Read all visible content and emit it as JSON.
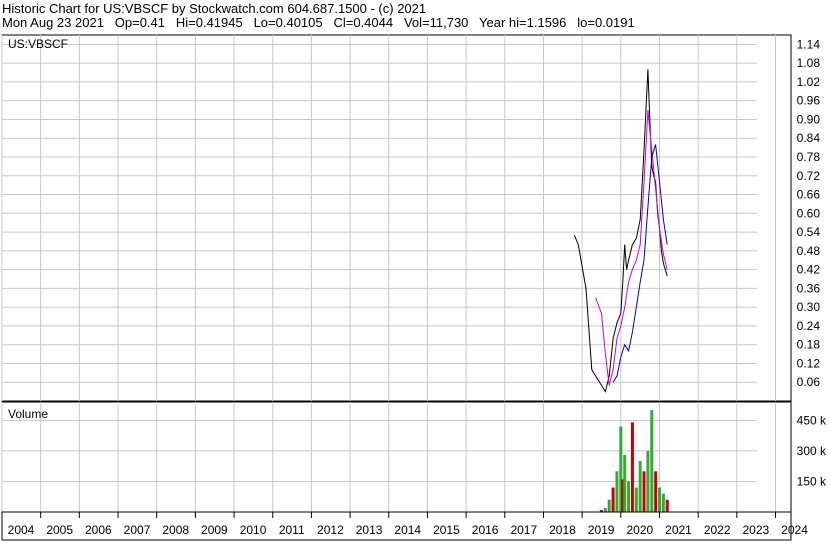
{
  "header": {
    "line1": "Historic Chart for US:VBSCF by Stockwatch.com 604.687.1500 - (c) 2021",
    "line2_date": "Mon Aug 23 2021",
    "line2_op": "Op=0.41",
    "line2_hi": "Hi=0.41945",
    "line2_lo": "Lo=0.40105",
    "line2_cl": "Cl=0.4044",
    "line2_vol": "Vol=11,730",
    "line2_yearhi": "Year hi=1.1596",
    "line2_lo2": "lo=0.0191"
  },
  "chart_data": [
    {
      "type": "line",
      "title": "US:VBSCF",
      "ylim": [
        0.0,
        1.17
      ],
      "y_ticks": [
        "1.14",
        "1.08",
        "1.02",
        "0.96",
        "0.90",
        "0.84",
        "0.78",
        "0.72",
        "0.66",
        "0.60",
        "0.54",
        "0.48",
        "0.42",
        "0.36",
        "0.30",
        "0.24",
        "0.18",
        "0.12",
        "0.06"
      ],
      "x_ticks": [
        "2004",
        "2005",
        "2006",
        "2007",
        "2008",
        "2009",
        "2010",
        "2011",
        "2012",
        "2013",
        "2014",
        "2015",
        "2016",
        "2017",
        "2018",
        "2019",
        "2020",
        "2021",
        "2022",
        "2023",
        "2024"
      ],
      "xlim": [
        2004.0,
        2024.4
      ],
      "grid": true,
      "series": [
        {
          "x": [
            2018.8,
            2018.9,
            2019.0,
            2019.1,
            2019.25,
            2019.4,
            2019.5,
            2019.6,
            2019.7,
            2019.8,
            2019.9,
            2020.0,
            2020.05,
            2020.1,
            2020.15,
            2020.2,
            2020.3,
            2020.4,
            2020.5,
            2020.6,
            2020.7,
            2020.75,
            2020.8,
            2020.85,
            2020.9,
            2020.95,
            2021.0,
            2021.05,
            2021.1,
            2021.15,
            2021.2
          ],
          "y": [
            0.53,
            0.5,
            0.43,
            0.36,
            0.1,
            0.07,
            0.05,
            0.03,
            0.08,
            0.2,
            0.25,
            0.28,
            0.38,
            0.5,
            0.42,
            0.45,
            0.5,
            0.52,
            0.58,
            0.8,
            1.06,
            0.9,
            0.75,
            0.72,
            0.7,
            0.6,
            0.55,
            0.48,
            0.44,
            0.42,
            0.4
          ],
          "color": "#000000"
        },
        {
          "x": [
            2019.35,
            2019.5,
            2019.6,
            2019.7,
            2019.8,
            2019.9,
            2020.0,
            2020.1,
            2020.2,
            2020.3,
            2020.4,
            2020.5,
            2020.6,
            2020.7,
            2020.8,
            2020.9,
            2021.0,
            2021.1,
            2021.2
          ],
          "y": [
            0.33,
            0.28,
            0.15,
            0.05,
            0.1,
            0.2,
            0.24,
            0.3,
            0.38,
            0.42,
            0.45,
            0.5,
            0.7,
            0.93,
            0.8,
            0.68,
            0.55,
            0.47,
            0.42
          ],
          "color": "#cc00cc"
        },
        {
          "x": [
            2019.8,
            2019.9,
            2020.0,
            2020.1,
            2020.2,
            2020.3,
            2020.4,
            2020.5,
            2020.6,
            2020.7,
            2020.8,
            2020.9,
            2021.0,
            2021.1,
            2021.2
          ],
          "y": [
            0.06,
            0.08,
            0.14,
            0.18,
            0.16,
            0.22,
            0.3,
            0.38,
            0.45,
            0.62,
            0.78,
            0.82,
            0.7,
            0.58,
            0.5
          ],
          "color": "#0000cc"
        }
      ]
    },
    {
      "type": "bar",
      "title": "Volume",
      "ylim": [
        0,
        540
      ],
      "y_ticks": [
        "450 k",
        "300 k",
        "150 k"
      ],
      "x": [
        2019.5,
        2019.6,
        2019.7,
        2019.8,
        2019.9,
        2020.0,
        2020.05,
        2020.1,
        2020.2,
        2020.3,
        2020.4,
        2020.5,
        2020.6,
        2020.7,
        2020.8,
        2020.9,
        2021.0,
        2021.1,
        2021.2
      ],
      "values": [
        10,
        20,
        60,
        120,
        200,
        420,
        160,
        280,
        150,
        440,
        120,
        250,
        200,
        300,
        500,
        200,
        120,
        90,
        60
      ]
    }
  ]
}
